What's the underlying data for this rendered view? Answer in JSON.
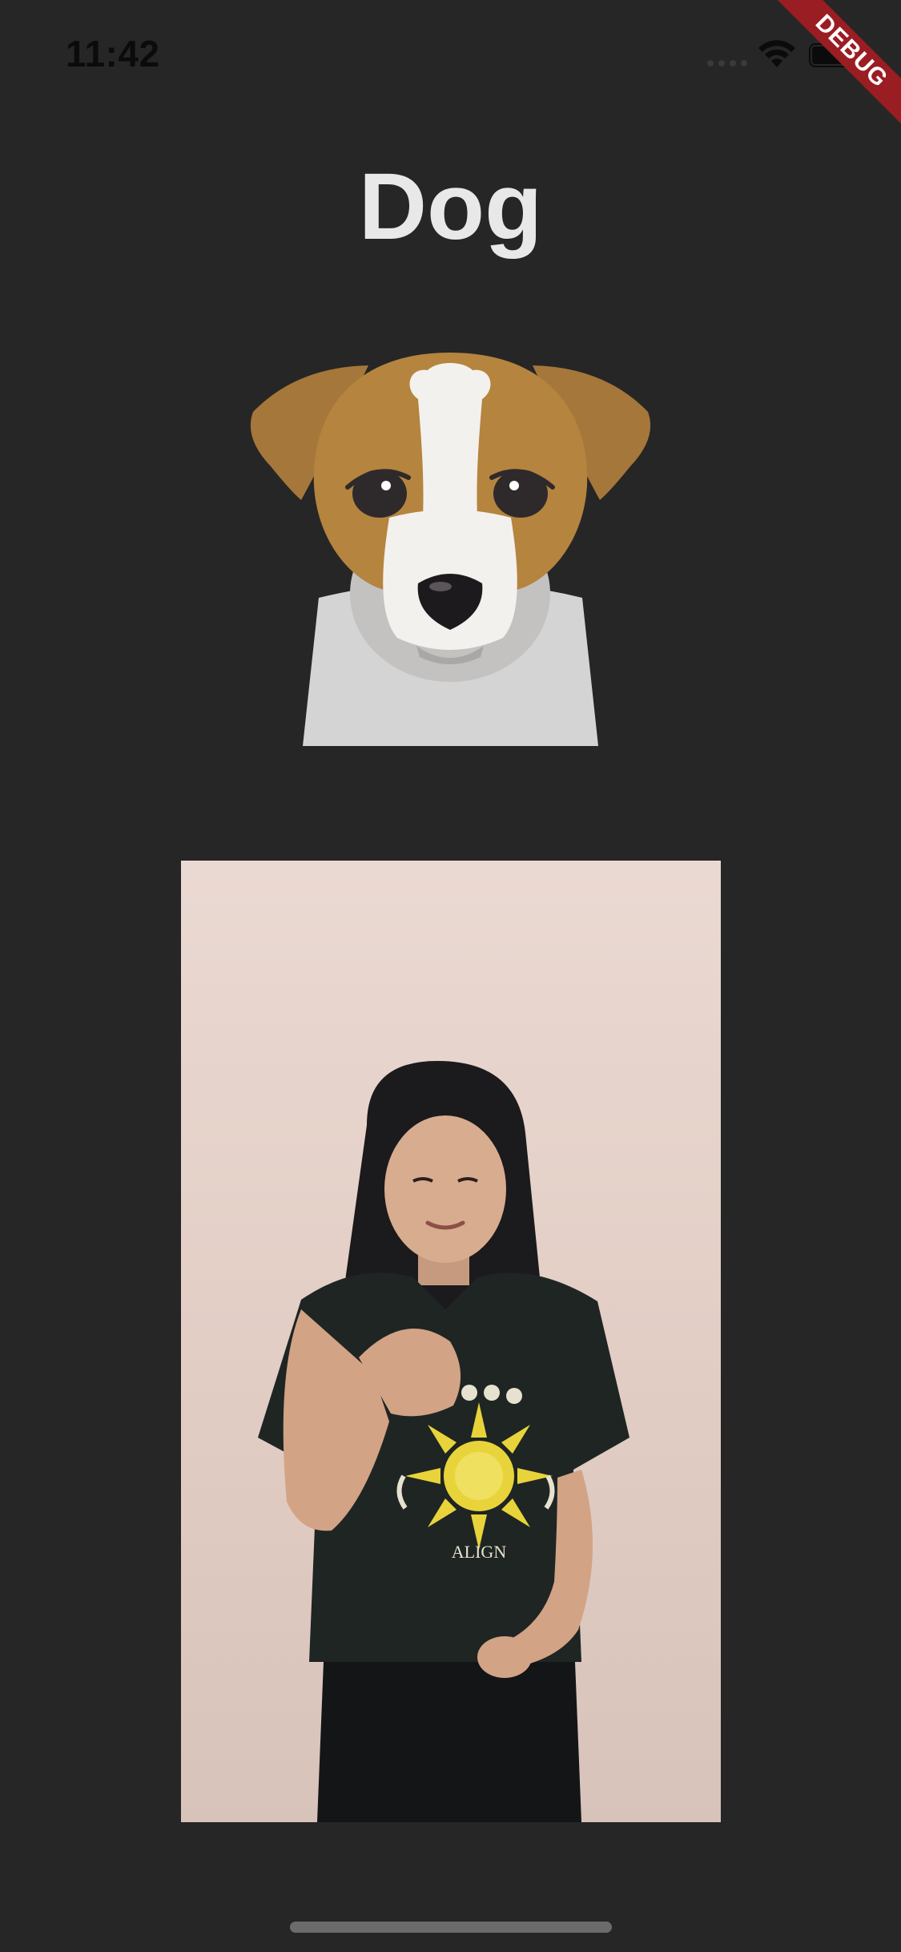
{
  "status_bar": {
    "time": "11:42",
    "signal_icon": "signal-dots-icon",
    "wifi_icon": "wifi-icon",
    "battery_icon": "battery-icon"
  },
  "debug_banner": {
    "label": "DEBUG",
    "color": "#9b1d24"
  },
  "page": {
    "title": "Dog",
    "background": "#262626"
  },
  "illustration": {
    "icon": "dog-illustration-icon",
    "colors": {
      "fur_brown": "#b5843e",
      "ear_brown": "#a5773a",
      "muzzle_white": "#f2f1ee",
      "body_gray": "#d4d4d4"
    }
  },
  "photo": {
    "shirt_text": "ALIGN"
  }
}
